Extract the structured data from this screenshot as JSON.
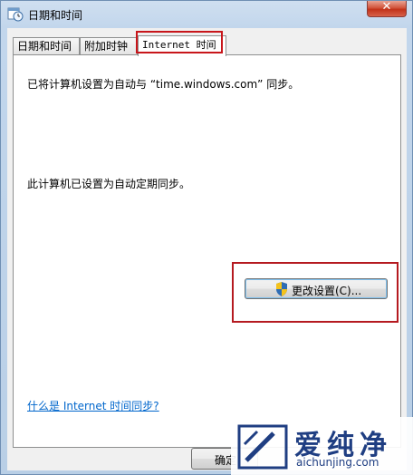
{
  "window": {
    "title": "日期和时间",
    "close_glyph": "✕"
  },
  "tabs": [
    {
      "label": "日期和时间"
    },
    {
      "label": "附加时钟"
    },
    {
      "label": "Internet 时间"
    }
  ],
  "panel": {
    "sync_server_text": "已将计算机设置为自动与 “time.windows.com” 同步。",
    "auto_sync_text": "此计算机已设置为自动定期同步。",
    "change_settings_label": "更改设置(C)...",
    "help_link": "什么是 Internet 时间同步?"
  },
  "footer": {
    "ok_label": "确定"
  },
  "watermark": {
    "cn": "爱纯净",
    "en": "aichunjing.com",
    "color": "#1f3e82"
  },
  "colors": {
    "highlight_red": "#c8161b",
    "link_blue": "#0066cc"
  },
  "icons": {
    "title": "calendar-clock-icon",
    "button": "uac-shield-icon"
  }
}
